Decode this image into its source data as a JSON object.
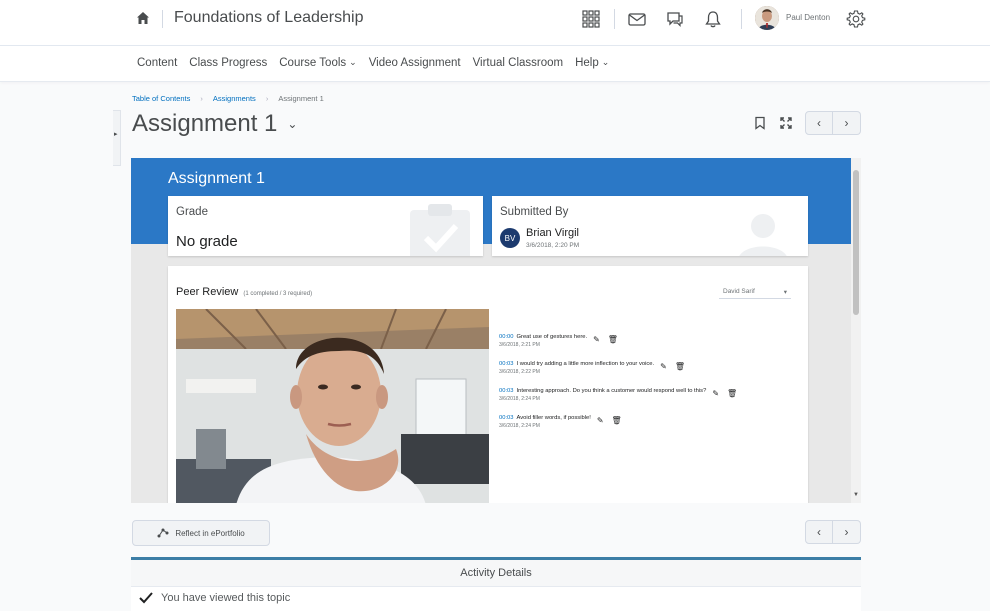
{
  "header": {
    "course_title": "Foundations of Leadership",
    "user_name": "Paul Denton"
  },
  "nav": {
    "items": [
      {
        "label": "Content",
        "dropdown": false
      },
      {
        "label": "Class Progress",
        "dropdown": false
      },
      {
        "label": "Course Tools",
        "dropdown": true
      },
      {
        "label": "Video Assignment",
        "dropdown": false
      },
      {
        "label": "Virtual Classroom",
        "dropdown": false
      },
      {
        "label": "Help",
        "dropdown": true
      }
    ]
  },
  "breadcrumb": {
    "items": [
      "Table of Contents",
      "Assignments",
      "Assignment 1"
    ]
  },
  "page": {
    "title": "Assignment 1"
  },
  "assignment": {
    "banner_title": "Assignment 1",
    "grade_label": "Grade",
    "grade_value": "No grade",
    "submitted_by_label": "Submitted By",
    "submitter_initials": "BV",
    "submitter_name": "Brian Virgil",
    "submitted_date": "3/6/2018, 2:20 PM"
  },
  "peer_review": {
    "title": "Peer Review",
    "count": "(1 completed / 3 required)",
    "reviewer": "David Sarif",
    "comments": [
      {
        "time": "00:00",
        "text": "Great use of gestures here.",
        "date": "3/6/2018, 2:21 PM"
      },
      {
        "time": "00:03",
        "text": "I would try adding a little more inflection to your voice.",
        "date": "3/6/2018, 2:22 PM"
      },
      {
        "time": "00:03",
        "text": "Interesting approach. Do you think a customer would respond well to this?",
        "date": "3/6/2018, 2:24 PM"
      },
      {
        "time": "00:03",
        "text": "Avoid filler words, if possible!",
        "date": "3/6/2018, 2:24 PM"
      }
    ]
  },
  "footer": {
    "reflect_label": "Reflect in ePortfolio",
    "activity_title": "Activity Details",
    "viewed_text": "You have viewed this topic"
  },
  "colors": {
    "banner": "#2b78c6",
    "link": "#006fbf",
    "accent_bar": "#3c7ea6"
  }
}
